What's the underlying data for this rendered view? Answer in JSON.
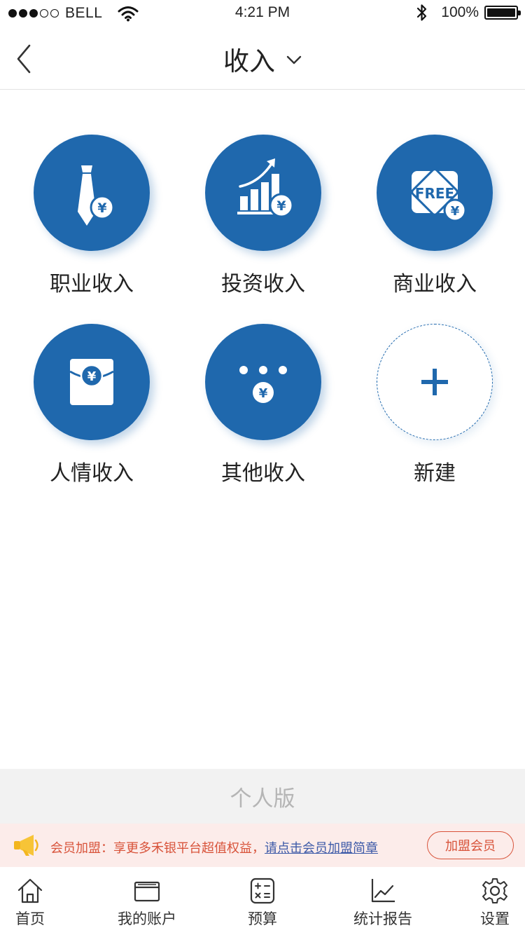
{
  "status_bar": {
    "carrier": "BELL",
    "time": "4:21 PM",
    "battery_percent": "100%",
    "battery_level": 1.0,
    "signal_bars_filled": 3,
    "signal_bars_total": 5
  },
  "nav": {
    "title": "收入",
    "back_icon": "chevron-left-icon",
    "dropdown_icon": "chevron-down-icon"
  },
  "categories": [
    {
      "label": "职业收入",
      "icon": "tie-yen-icon"
    },
    {
      "label": "投资收入",
      "icon": "bar-chart-growth-yen-icon"
    },
    {
      "label": "商业收入",
      "icon": "free-tag-yen-icon",
      "badge_text": "FREE"
    },
    {
      "label": "人情收入",
      "icon": "red-envelope-yen-icon"
    },
    {
      "label": "其他收入",
      "icon": "more-dots-yen-icon"
    },
    {
      "label": "新建",
      "icon": "plus-icon"
    }
  ],
  "currency_symbol": "¥",
  "version": {
    "label": "个人版"
  },
  "member_banner": {
    "text": "会员加盟：享更多禾银平台超值权益，",
    "link_text": "请点击会员加盟简章",
    "button_label": "加盟会员",
    "icon": "megaphone-icon"
  },
  "tabs": [
    {
      "label": "首页",
      "icon": "home-icon"
    },
    {
      "label": "我的账户",
      "icon": "wallet-icon"
    },
    {
      "label": "预算",
      "icon": "calculator-icon"
    },
    {
      "label": "统计报告",
      "icon": "line-chart-icon"
    },
    {
      "label": "设置",
      "icon": "gear-icon"
    }
  ],
  "colors": {
    "primary_blue": "#1f68ad",
    "banner_red": "#d8533a",
    "banner_bg": "#fcecea",
    "link_blue": "#3d5aa8",
    "version_bg": "#f2f2f2",
    "version_text": "#b5b5b5"
  }
}
